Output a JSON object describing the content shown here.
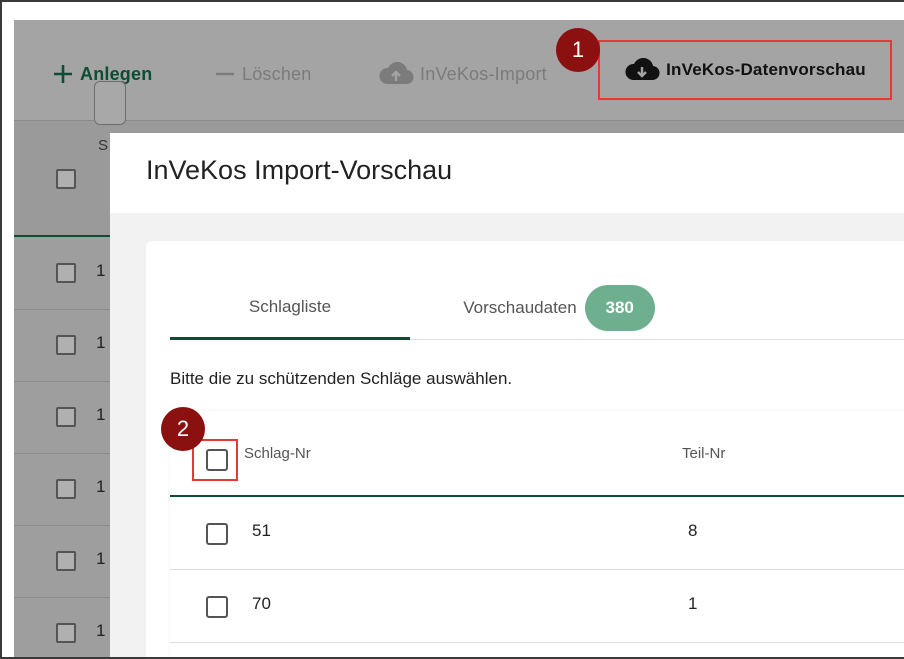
{
  "toolbar": {
    "add_label": "Anlegen",
    "delete_label": "Löschen",
    "import_label": "InVeKos-Import",
    "preview_label": "InVeKos-Datenvorschau"
  },
  "markers": {
    "one": "1",
    "two": "2"
  },
  "background_table": {
    "header_partial": "S",
    "row_labels": [
      "1",
      "1",
      "1",
      "1",
      "1",
      "1"
    ]
  },
  "dialog": {
    "title": "InVeKos Import-Vorschau",
    "tabs": [
      {
        "label": "Schlagliste"
      },
      {
        "label": "Vorschaudaten",
        "badge": "380"
      }
    ],
    "hint": "Bitte die zu schützenden Schläge auswählen.",
    "table": {
      "columns": [
        "Schlag-Nr",
        "Teil-Nr"
      ],
      "rows": [
        {
          "schlag_nr": "51",
          "teil_nr": "8"
        },
        {
          "schlag_nr": "70",
          "teil_nr": "1"
        }
      ]
    }
  },
  "colors": {
    "accent_green": "#0d4d33",
    "badge_green": "#6daf8e",
    "highlight_red": "#e53935",
    "marker_red": "#8b1010"
  }
}
